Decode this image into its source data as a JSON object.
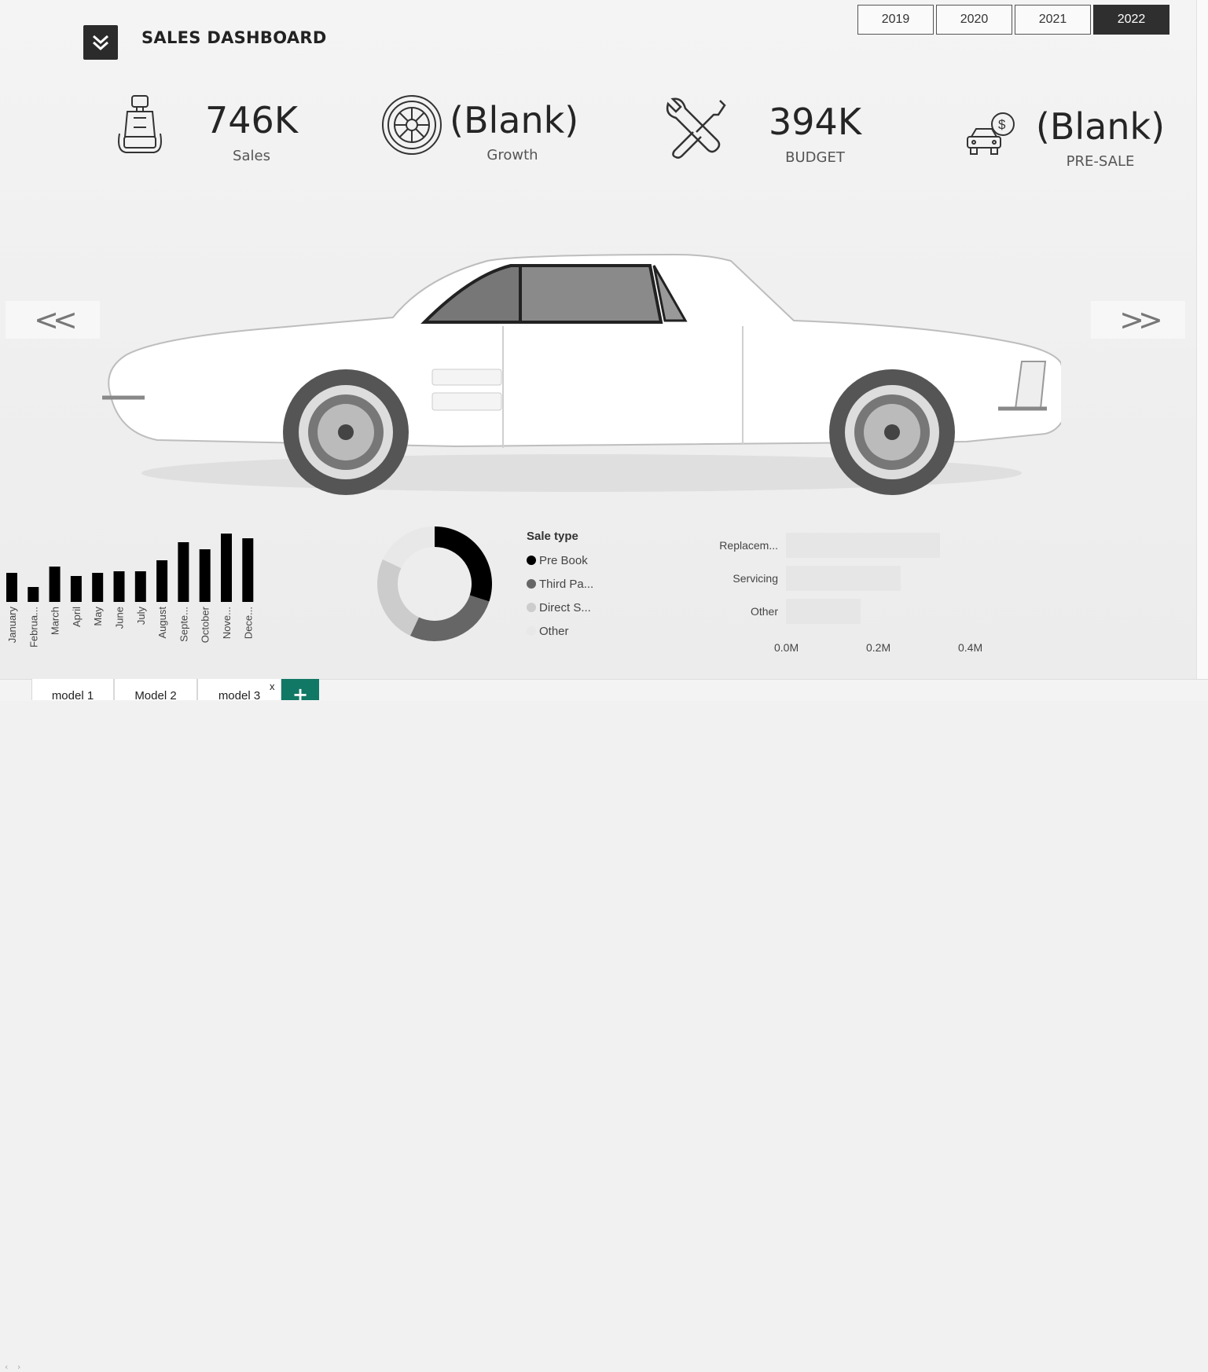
{
  "header": {
    "title": "SALES DASHBOARD"
  },
  "years": {
    "options": [
      "2019",
      "2020",
      "2021",
      "2022"
    ],
    "selected": "2022"
  },
  "kpis": [
    {
      "value": "746K",
      "label": "Sales",
      "icon": "car-seat-icon"
    },
    {
      "value": "(Blank)",
      "label": "Growth",
      "icon": "wheel-icon"
    },
    {
      "value": "394K",
      "label": "BUDGET",
      "icon": "tools-icon"
    },
    {
      "value": "(Blank)",
      "label": "PRE-SALE",
      "icon": "car-money-icon"
    }
  ],
  "nav": {
    "prev": "<<",
    "next": ">>"
  },
  "chart_data": [
    {
      "type": "bar",
      "categories": [
        "January",
        "Februa...",
        "March",
        "April",
        "May",
        "June",
        "July",
        "August",
        "Septe...",
        "October",
        "Nove...",
        "Dece..."
      ],
      "values": [
        37,
        19,
        45,
        33,
        37,
        39,
        39,
        53,
        76,
        67,
        87,
        81
      ],
      "color": "#000000"
    },
    {
      "type": "pie",
      "title": "Sale type",
      "labels": [
        "Pre Book",
        "Third Pa...",
        "Direct S...",
        "Other"
      ],
      "values": [
        30,
        27,
        25,
        18
      ],
      "colors": [
        "#000000",
        "#666666",
        "#cccccc",
        "#e8e8e8"
      ]
    },
    {
      "type": "bar",
      "orientation": "horizontal",
      "categories": [
        "Replacem...",
        "Servicing",
        "Other"
      ],
      "values": [
        0.335,
        0.25,
        0.163
      ],
      "xticks": [
        "0.0M",
        "0.2M",
        "0.4M"
      ],
      "xlim": [
        0,
        0.4
      ],
      "color": "#e6e6e6"
    }
  ],
  "tabs": {
    "items": [
      "model 1",
      "Model 2",
      "model 3"
    ],
    "active": "model 3",
    "close": "x",
    "add": "+"
  }
}
